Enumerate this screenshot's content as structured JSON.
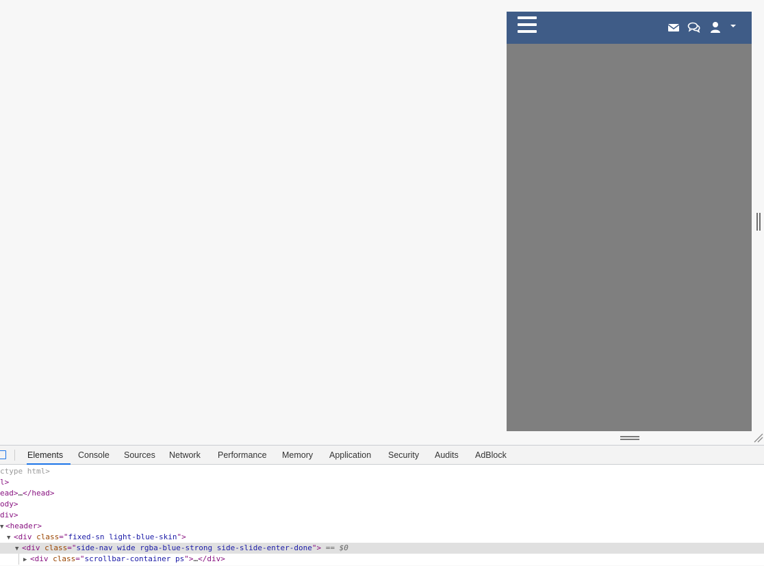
{
  "device": {
    "nav_color": "#3f5c87",
    "body_color": "#7f7f7f",
    "icons": [
      "hamburger-menu-icon",
      "mail-icon",
      "chat-icon",
      "user-icon",
      "caret-down-icon"
    ]
  },
  "devtools": {
    "tabs": [
      "Elements",
      "Console",
      "Sources",
      "Network",
      "Performance",
      "Memory",
      "Application",
      "Security",
      "Audits",
      "AdBlock"
    ],
    "active_tab": "Elements",
    "dom": [
      {
        "text": "ctype html>"
      },
      {
        "text": "l>"
      },
      {
        "open": "ead>",
        "ellipsis": "…",
        "close": "</head>"
      },
      {
        "text": "ody>"
      },
      {
        "text": "div>"
      },
      {
        "text": "<header>"
      },
      {
        "tag": "<div ",
        "attr": "class",
        "eq": "=\"",
        "val": "fixed-sn light-blue-skin",
        "end": "\">"
      },
      {
        "tag": "<div ",
        "attr": "class",
        "eq": "=\"",
        "val": "side-nav wide rgba-blue-strong side-slide-enter-done",
        "end": "\">",
        "marker": "== $0"
      },
      {
        "tag": "<div ",
        "attr": "class",
        "eq": "=\"",
        "val": "scrollbar-container ps",
        "end": "\">",
        "ellipsis": "…",
        "close": "</div>"
      }
    ]
  }
}
